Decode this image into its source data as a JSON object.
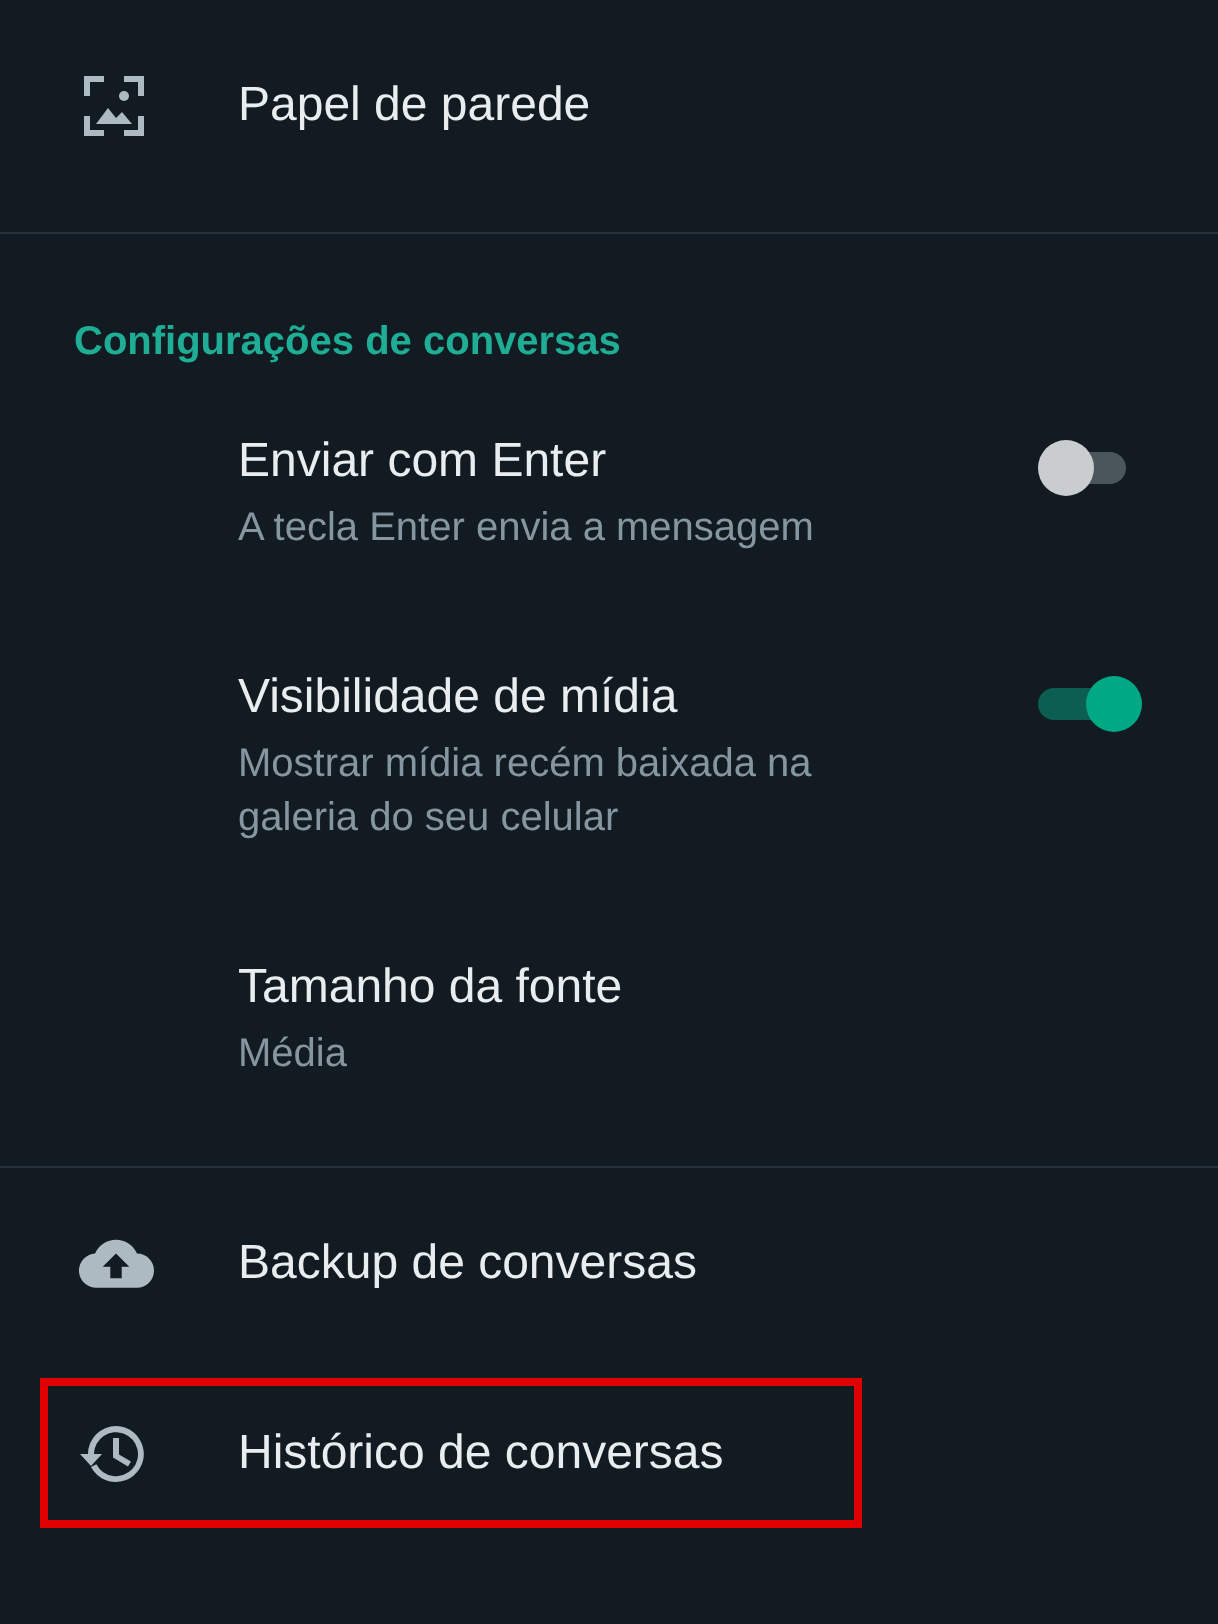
{
  "top_items": [
    {
      "kind": "wallpaper",
      "title": "Papel de parede"
    }
  ],
  "section": {
    "title": "Configurações de conversas",
    "items": [
      {
        "kind": "toggle",
        "title": "Enviar com Enter",
        "subtitle": "A tecla Enter envia a mensagem",
        "on": false
      },
      {
        "kind": "toggle",
        "title": "Visibilidade de mídia",
        "subtitle": "Mostrar mídia recém baixada na galeria do seu celular",
        "on": true
      },
      {
        "kind": "plain",
        "title": "Tamanho da fonte",
        "subtitle": "Média"
      }
    ]
  },
  "bottom_items": [
    {
      "kind": "backup",
      "title": "Backup de conversas",
      "highlighted": false
    },
    {
      "kind": "history",
      "title": "Histórico de conversas",
      "highlighted": true
    }
  ]
}
